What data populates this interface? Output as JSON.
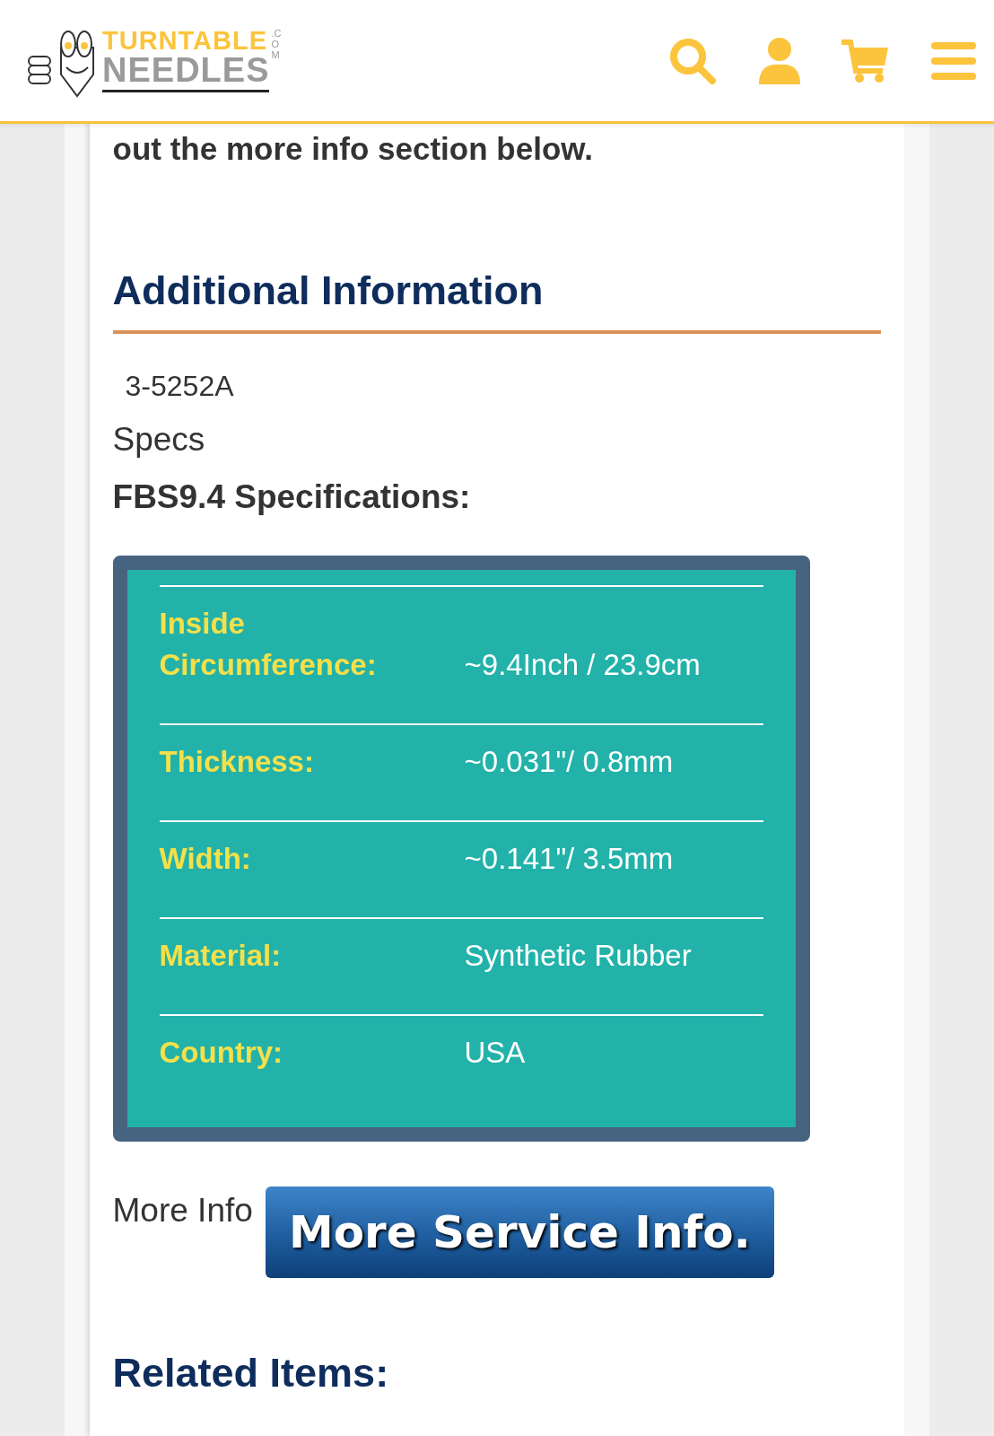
{
  "header": {
    "logo": {
      "line_1": "TURNTABLE",
      "line_2": "NEEDLES",
      "suffix": ".COM"
    }
  },
  "intro_tail": "out the more info section below.",
  "section_title": "Additional Information",
  "sku": "3-5252A",
  "specs_label": "Specs",
  "specs_title": "FBS9.4 Specifications:",
  "spec_rows": [
    {
      "label": "Inside Circumference:",
      "value": "~9.4Inch / 23.9cm"
    },
    {
      "label": "Thickness:",
      "value": "~0.031\"/ 0.8mm"
    },
    {
      "label": "Width:",
      "value": "~0.141\"/ 3.5mm"
    },
    {
      "label": "Material:",
      "value": "Synthetic Rubber"
    },
    {
      "label": "Country:",
      "value": "USA"
    }
  ],
  "more_info": {
    "label": "More Info",
    "button": "More Service Info."
  },
  "related_title": "Related Items:"
}
